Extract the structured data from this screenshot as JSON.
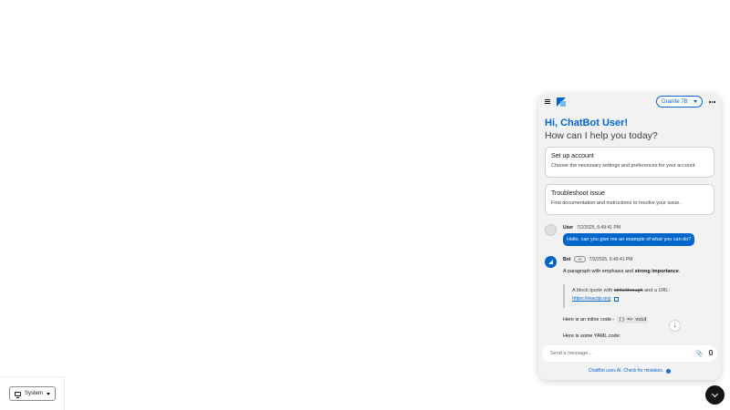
{
  "theme": {
    "label": "System"
  },
  "header": {
    "model": "Granite 7B"
  },
  "welcome": {
    "greeting": "Hi, ChatBot User!",
    "subtitle": "How can I help you today?"
  },
  "prompts": [
    {
      "title": "Set up account",
      "desc": "Choose the necessary settings and preferences for your account."
    },
    {
      "title": "Troubleshoot issue",
      "desc": "Find documentation and instructions to resolve your issue."
    }
  ],
  "messages": {
    "user": {
      "name": "User",
      "time": "7/2/2025, 6:49:41 PM",
      "text": "Hello, can you give me an example of what you can do?"
    },
    "bot": {
      "name": "Bot",
      "badge": "AI",
      "time": "7/2/2025, 6:49:41 PM",
      "para_pre": "A paragraph with emphasis and ",
      "para_strong": "strong importance",
      "para_post": ".",
      "quote_pre": "A block quote with ",
      "quote_strike": "strikethrough",
      "quote_post": " and a URL:",
      "quote_link": "https://reactjs.org",
      "inline_pre": "Here is an inline code - ",
      "inline_code": "() => void",
      "yaml": "Here is some YAML code:"
    }
  },
  "footer": {
    "placeholder": "Send a message...",
    "disclaimer": "ChatBot uses AI. Check for mistakes."
  },
  "colors": {
    "accent": "#0066cc",
    "fab": "#151515"
  }
}
